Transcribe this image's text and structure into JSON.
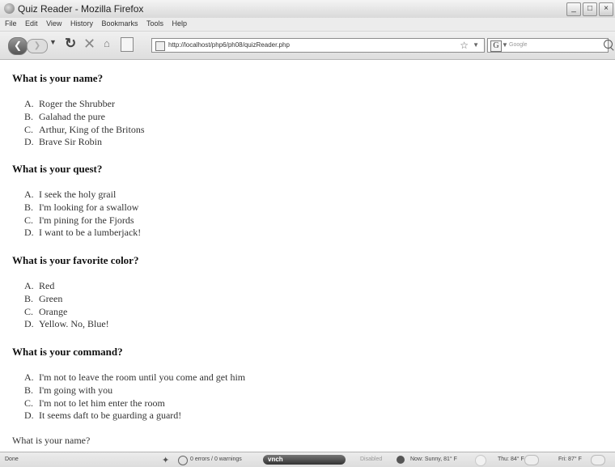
{
  "window": {
    "title": "Quiz Reader - Mozilla Firefox",
    "controls": [
      "_",
      "□",
      "×"
    ]
  },
  "menu": [
    "File",
    "Edit",
    "View",
    "History",
    "Bookmarks",
    "Tools",
    "Help"
  ],
  "toolbar": {
    "url": "http://localhost/php6/ph08/quizReader.php",
    "search_placeholder": "Google"
  },
  "quiz": [
    {
      "question": "What is your name?",
      "answers": [
        {
          "letter": "A.",
          "text": "Roger the Shrubber"
        },
        {
          "letter": "B.",
          "text": "Galahad the pure"
        },
        {
          "letter": "C.",
          "text": "Arthur, King of the Britons"
        },
        {
          "letter": "D.",
          "text": "Brave Sir Robin"
        }
      ]
    },
    {
      "question": "What is your quest?",
      "answers": [
        {
          "letter": "A.",
          "text": "I seek the holy grail"
        },
        {
          "letter": "B.",
          "text": "I'm looking for a swallow"
        },
        {
          "letter": "C.",
          "text": "I'm pining for the Fjords"
        },
        {
          "letter": "D.",
          "text": "I want to be a lumberjack!"
        }
      ]
    },
    {
      "question": "What is your favorite color?",
      "answers": [
        {
          "letter": "A.",
          "text": "Red"
        },
        {
          "letter": "B.",
          "text": "Green"
        },
        {
          "letter": "C.",
          "text": "Orange"
        },
        {
          "letter": "D.",
          "text": "Yellow. No, Blue!"
        }
      ]
    },
    {
      "question": "What is your command?",
      "answers": [
        {
          "letter": "A.",
          "text": "I'm not to leave the room until you come and get him"
        },
        {
          "letter": "B.",
          "text": "I'm going with you"
        },
        {
          "letter": "C.",
          "text": "I'm not to let him enter the room"
        },
        {
          "letter": "D.",
          "text": "It seems daft to be guarding a guard!"
        }
      ]
    }
  ],
  "footer_question": "What is your name?",
  "statusbar": {
    "done": "Done",
    "errors": "0 errors / 0 warnings",
    "vnc": "vnch",
    "disabled": "Disabled",
    "now": "Now: Sunny, 81° F",
    "thu": "Thu: 84° F",
    "fri": "Fri: 87° F"
  }
}
